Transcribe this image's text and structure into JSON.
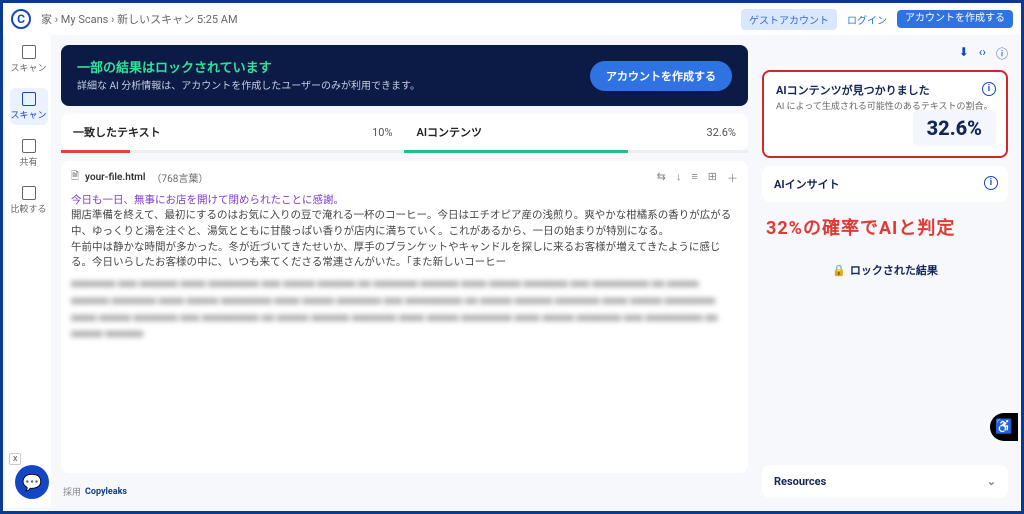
{
  "brand_letter": "C",
  "breadcrumb": {
    "root": "家",
    "sep": "›",
    "mid": "My Scans",
    "leaf": "新しいスキャン 5:25 AM"
  },
  "top_buttons": {
    "guest": "ゲストアカウント",
    "login": "ログイン",
    "create": "アカウントを作成する"
  },
  "rail": [
    {
      "label": "スキャン"
    },
    {
      "label": "スキャン"
    },
    {
      "label": "共有"
    },
    {
      "label": "比較する"
    }
  ],
  "banner": {
    "title": "一部の結果はロックされています",
    "desc": "詳細な AI 分析情報は、アカウントを作成したユーザーのみが利用できます。",
    "cta": "アカウントを作成する"
  },
  "tabs": {
    "a_label": "一致したテキスト",
    "a_pct": "10%",
    "b_label": "AIコンテンツ",
    "b_pct": "32.6%"
  },
  "doc": {
    "file_icon": "🗎",
    "filename": "your-file.html",
    "wordcount": "（768言葉）",
    "tools": [
      "⇆",
      "↓",
      "≡",
      "⊞",
      "＋"
    ],
    "visible_lines": [
      "今日も一日、無事にお店を開けて閉められたことに感謝。",
      "開店準備を終えて、最初にするのはお気に入りの豆で淹れる一杯のコーヒー。今日はエチオピア産の浅煎り。爽やかな柑橘系の香りが広がる中、ゆっくりと湯を注ぐと、湯気とともに甘酸っぱい香りが店内に満ちていく。これがあるから、一日の始まりが特別になる。",
      "午前中は静かな時間が多かった。冬が近づいてきたせいか、厚手のブランケットやキャンドルを探しに来るお客様が増えてきたように感じる。今日いらしたお客様の中に、いつも来てくださる常連さんがいた。「また新しいコーヒー"
    ],
    "blurred_placeholder": "■■■■■■■ ■■■ ■■■■■■ ■■■■ ■■■■■■■■ ■■■ ■■■■■ ■■■■■■ ■■ ■■■■■■■ ■■■■■■ ■■■■ ■■■■■ ■■■■■■■ ■■■ ■■■■■■■■■ ■■ ■■■■■ ■■■■■■ ■■■■■■■ ■■■■ ■■■■■ ■■■■■■■■ ■■■■ ■■■■■ ■■■■■■■ ■■■ ■■■■■■■■■ ■■ ■■■■■ ■■■■■■ ■■■■■■■ ■■■■ ■■■■■ ■■■■■■■■ ■■■■ ■■■■■ ■■■■■■■ ■■■ ■■■■■■■■■ ■■ ■■■■■ ■■■■■■ ■■■■■■■ ■■■■ ■■■■■ ■■■■■■■■ ■■■■ ■■■■■ ■■■■■■■ ■■■ ■■■■■■■■■ ■■ ■■■■■ ■■■■■■"
  },
  "footer": {
    "powered_prefix": "採用",
    "brand": "Copyleaks"
  },
  "side": {
    "tool_icons": [
      "⬇",
      "‹›",
      "ⓘ"
    ],
    "ai_found_title": "AIコンテンツが見つかりました",
    "ai_found_desc": "AI によって生成される可能性のあるテキストの割合。",
    "ai_found_pct": "32.6%",
    "insight_title": "AIインサイト",
    "annotation": "32%の確率でAIと判定",
    "locked_label": "ロックされた結果",
    "resources_label": "Resources"
  },
  "misc": {
    "chat": "💬",
    "accessibility": "♿",
    "x": "x",
    "info_glyph": "i",
    "lock_glyph": "🔒",
    "chevron": "⌄"
  }
}
